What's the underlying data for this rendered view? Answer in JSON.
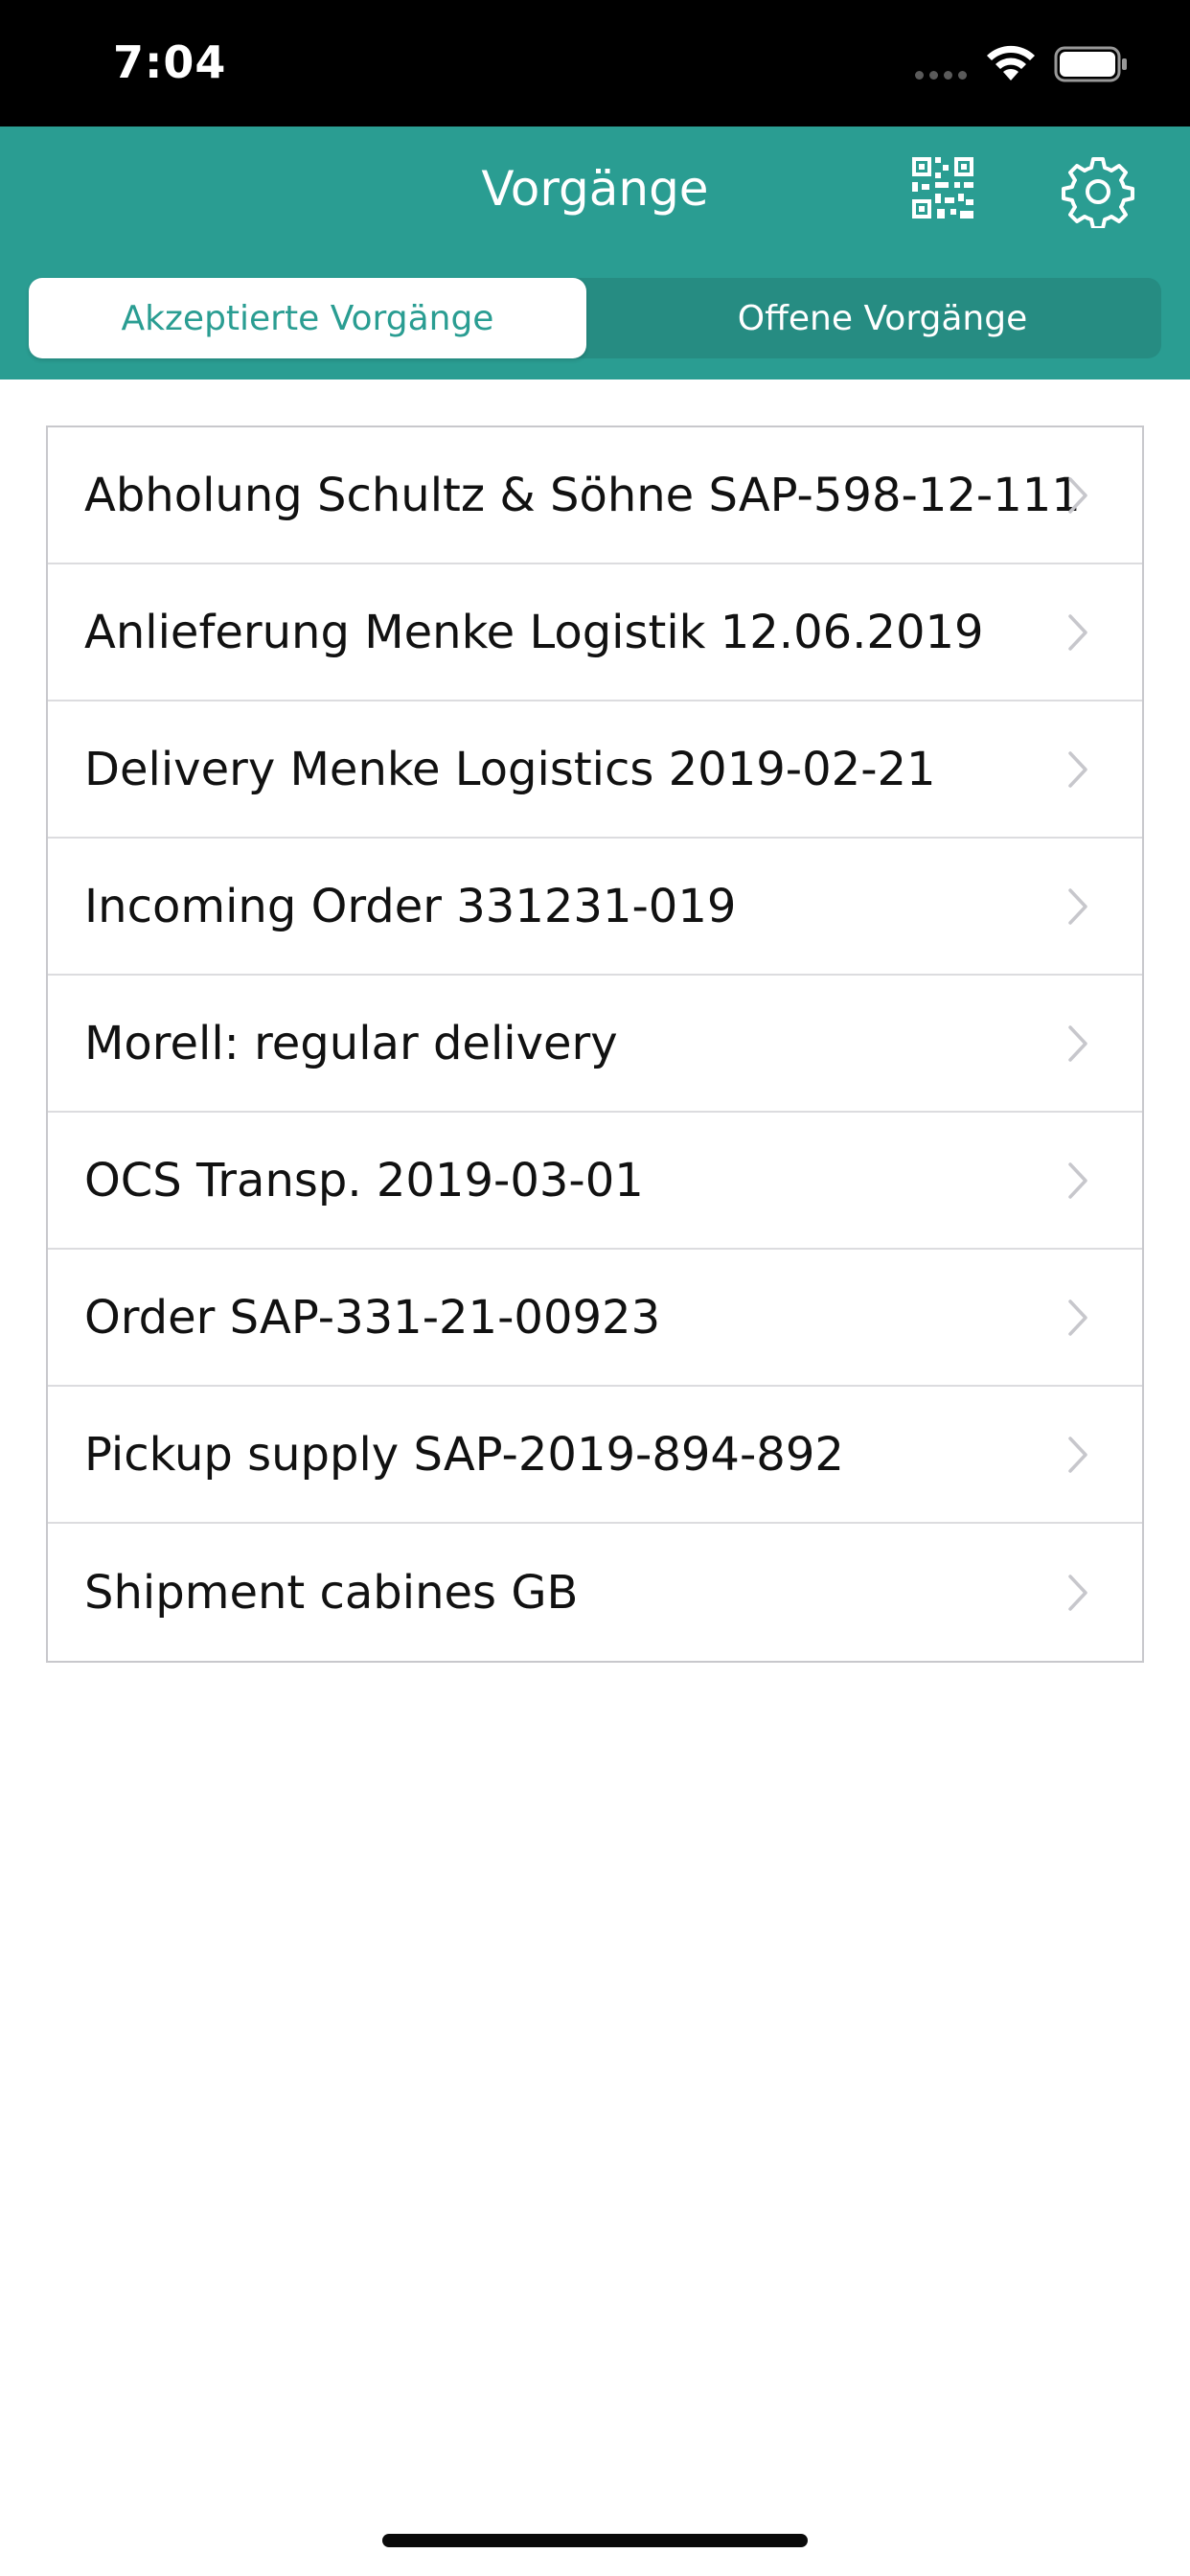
{
  "status_bar": {
    "time": "7:04"
  },
  "nav": {
    "title": "Vorgänge",
    "icons": [
      "qr-code-icon",
      "gear-icon"
    ],
    "accent_color": "#2a9d92"
  },
  "tabs": [
    {
      "label": "Akzeptierte Vorgänge",
      "selected": true
    },
    {
      "label": "Offene Vorgänge",
      "selected": false
    }
  ],
  "list": {
    "items": [
      {
        "label": "Abholung Schultz & Söhne SAP-598-12-111"
      },
      {
        "label": "Anlieferung Menke Logistik 12.06.2019"
      },
      {
        "label": "Delivery Menke Logistics 2019-02-21"
      },
      {
        "label": "Incoming Order 331231-019"
      },
      {
        "label": "Morell: regular delivery"
      },
      {
        "label": "OCS Transp. 2019-03-01"
      },
      {
        "label": "Order SAP-331-21-00923"
      },
      {
        "label": "Pickup supply SAP-2019-894-892"
      },
      {
        "label": "Shipment cabines GB"
      }
    ]
  }
}
